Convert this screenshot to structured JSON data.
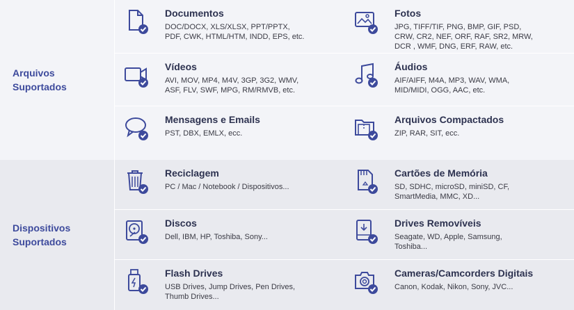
{
  "sections": [
    {
      "label": "Arquivos\nSuportados",
      "items": [
        {
          "title": "Documentos",
          "desc": "DOC/DOCX, XLS/XLSX, PPT/PPTX,\nPDF, CWK, HTML/HTM, INDD, EPS, etc.",
          "icon": "document-icon"
        },
        {
          "title": "Fotos",
          "desc": "JPG, TIFF/TIF, PNG, BMP, GIF, PSD,\nCRW, CR2, NEF, ORF, RAF, SR2, MRW,\nDCR , WMF, DNG, ERF, RAW, etc.",
          "icon": "photo-icon"
        },
        {
          "title": "Vídeos",
          "desc": "AVI, MOV, MP4, M4V, 3GP, 3G2, WMV,\nASF, FLV, SWF, MPG, RM/RMVB, etc.",
          "icon": "video-camera-icon"
        },
        {
          "title": "Áudios",
          "desc": "AIF/AIFF, M4A, MP3, WAV, WMA,\nMID/MIDI, OGG, AAC, etc.",
          "icon": "music-note-icon"
        },
        {
          "title": "Mensagens e Emails",
          "desc": "PST, DBX, EMLX, ecc.",
          "icon": "chat-bubble-icon"
        },
        {
          "title": "Arquivos Compactados",
          "desc": "ZIP, RAR, SIT, ecc.",
          "icon": "archive-folder-icon"
        }
      ]
    },
    {
      "label": "Dispositivos\nSuportados",
      "items": [
        {
          "title": "Reciclagem",
          "desc": "PC / Mac / Notebook / Dispositivos...",
          "icon": "trash-bin-icon"
        },
        {
          "title": "Cartões de Memória",
          "desc": "SD, SDHC, microSD, miniSD, CF,\nSmartMedia, MMC, XD...",
          "icon": "memory-card-icon"
        },
        {
          "title": "Discos",
          "desc": "Dell, IBM, HP, Toshiba, Sony...",
          "icon": "hard-disk-icon"
        },
        {
          "title": "Drives Removíveis",
          "desc": "Seagate, WD, Apple, Samsung,\nToshiba...",
          "icon": "removable-drive-icon"
        },
        {
          "title": "Flash Drives",
          "desc": "USB Drives, Jump Drives, Pen Drives,\nThumb Drives...",
          "icon": "usb-drive-icon"
        },
        {
          "title": "Cameras/Camcorders Digitais",
          "desc": "Canon, Kodak, Nikon, Sony, JVC...",
          "icon": "camera-icon"
        }
      ]
    }
  ],
  "colors": {
    "accent": "#3d4a9c",
    "icon_stroke": "#3d4a9c",
    "check_fill": "#3d4a9c"
  }
}
